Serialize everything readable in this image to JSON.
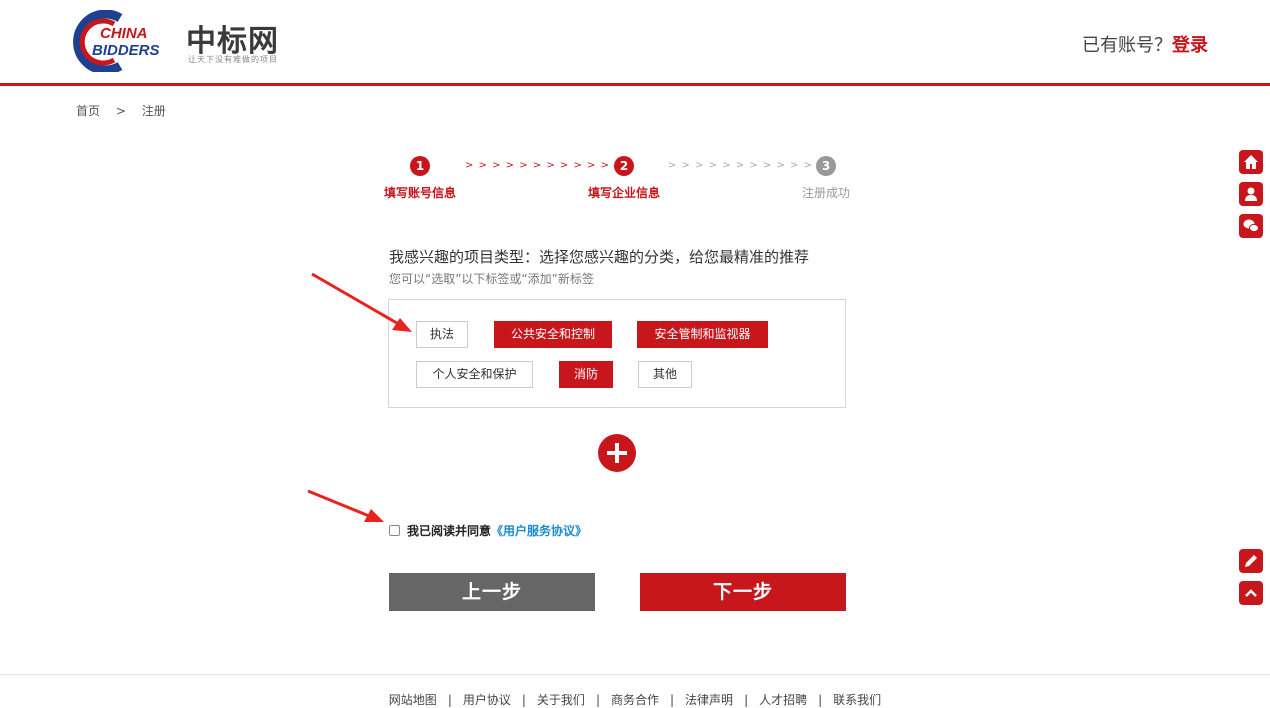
{
  "header": {
    "logo_en_line1": "CHINA",
    "logo_en_line2": "BIDDERS",
    "logo_cn": "中标网",
    "slogan": "让天下没有难做的项目",
    "account_prompt": "已有账号？",
    "login_label": "登录"
  },
  "breadcrumb": {
    "home": "首页",
    "separator": ">",
    "current": "注册"
  },
  "steps": [
    {
      "num": "1",
      "label": "填写账号信息",
      "state": "active"
    },
    {
      "num": "2",
      "label": "填写企业信息",
      "state": "active"
    },
    {
      "num": "3",
      "label": "注册成功",
      "state": "pending"
    }
  ],
  "step_arrows": "> > > > > > > > > > > >",
  "interest": {
    "title": "我感兴趣的项目类型：选择您感兴趣的分类，给您最精准的推荐",
    "subtitle": "您可以“选取”以下标签或“添加”新标签",
    "tags": [
      {
        "label": "执法",
        "selected": false
      },
      {
        "label": "公共安全和控制",
        "selected": true
      },
      {
        "label": "安全管制和监视器",
        "selected": true
      },
      {
        "label": "个人安全和保护",
        "selected": false
      },
      {
        "label": "消防",
        "selected": true
      },
      {
        "label": "其他",
        "selected": false
      }
    ]
  },
  "agreement": {
    "text": "我已阅读并同意",
    "link": "《用户服务协议》",
    "checked": false
  },
  "buttons": {
    "prev": "上一步",
    "next": "下一步"
  },
  "footer": {
    "links": [
      "网站地图",
      "用户协议",
      "关于我们",
      "商务合作",
      "法律声明",
      "人才招聘",
      "联系我们"
    ],
    "separator": "|"
  },
  "colors": {
    "brand_red": "#c8161d",
    "gray_button": "#666666",
    "link_blue": "#1a8bd1"
  },
  "icons": {
    "float_toolbar": [
      "home-icon",
      "user-icon",
      "wechat-icon",
      "edit-icon",
      "back-to-top-icon"
    ]
  }
}
